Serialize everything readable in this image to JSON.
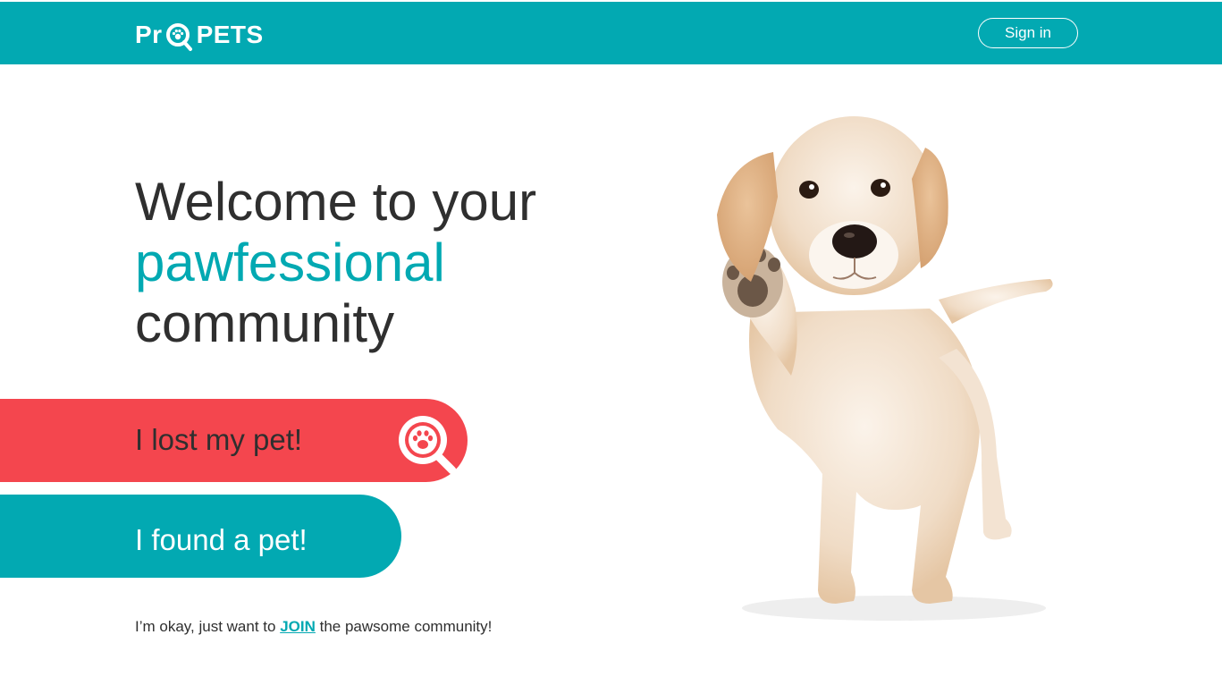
{
  "header": {
    "logo_left": "Pr",
    "logo_right": "PETS",
    "signin_label": "Sign in"
  },
  "hero": {
    "line1": "Welcome to your",
    "line2": "pawfessional",
    "line3": "community"
  },
  "actions": {
    "lost_label": "I lost my pet!",
    "found_label": "I found a pet!"
  },
  "join": {
    "prefix": "I’m okay, just want to",
    "link": "JOIN",
    "suffix": "the pawsome community!"
  },
  "colors": {
    "brand_teal": "#02a9b2",
    "lost_red": "#f4464e",
    "text_dark": "#2f2f2f"
  },
  "icons": {
    "logo_mark": "magnifier-paw-icon",
    "lost_icon": "magnifier-paw-icon"
  }
}
